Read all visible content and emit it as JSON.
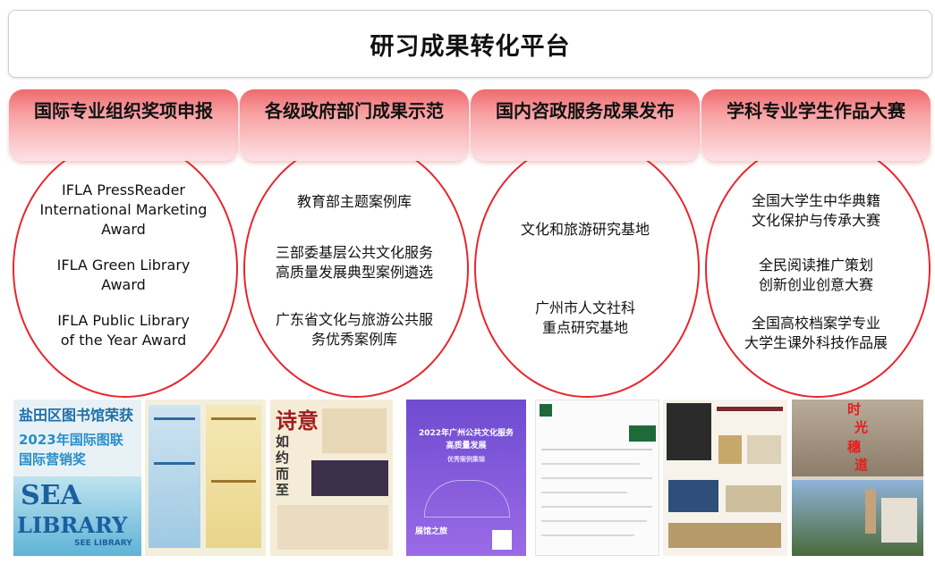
{
  "title": "研习成果转化平台",
  "columns": [
    {
      "label": "国际专业组织奖项申报",
      "items": [
        {
          "lines": [
            "IFLA PressReader",
            "International Marketing",
            "Award"
          ]
        },
        {
          "lines": [
            "IFLA Green Library",
            "Award"
          ]
        },
        {
          "lines": [
            "IFLA Public Library",
            "of the Year Award"
          ]
        }
      ]
    },
    {
      "label": "各级政府部门成果示范",
      "items": [
        {
          "lines": [
            "教育部主题案例库"
          ]
        },
        {
          "lines": [
            "三部委基层公共文化服务",
            "高质量发展典型案例遴选"
          ]
        },
        {
          "lines": [
            "广东省文化与旅游公共服",
            "务优秀案例库"
          ]
        }
      ]
    },
    {
      "label": "国内咨政服务成果发布",
      "items": [
        {
          "lines": [
            "文化和旅游研究基地"
          ]
        },
        {
          "lines": [
            "广州市人文社科",
            "重点研究基地"
          ]
        }
      ]
    },
    {
      "label": "学科专业学生作品大赛",
      "items": [
        {
          "lines": [
            "全国大学生中华典籍",
            "文化保护与传承大赛"
          ]
        },
        {
          "lines": [
            "全民阅读推广策划",
            "创新创业创意大赛"
          ]
        },
        {
          "lines": [
            "全国高校档案学专业",
            "大学生课外科技作品展"
          ]
        }
      ]
    }
  ],
  "thumbnails": {
    "seal_poster": {
      "line1": "盐田区图书馆荣获",
      "line2": "2023年国际图联",
      "line3": "国际营销奖",
      "word1": "SEA",
      "word2": "LIBRARY",
      "word3": "SEE LIBRARY"
    },
    "poem_poster": {
      "line1": "诗意",
      "line2": "如约而至"
    },
    "case_cover": {
      "line1": "2022年广州公共文化服务",
      "line2": "高质量发展",
      "line3": "优秀案例集锦",
      "line4": "展馆之旅"
    },
    "photo_collage": {
      "chars": [
        "时",
        "光",
        "穗",
        "道"
      ]
    }
  },
  "colors": {
    "accent": "#e7262d",
    "tab_top": "#ee6a6e",
    "tab_bottom": "#fde2e3"
  }
}
